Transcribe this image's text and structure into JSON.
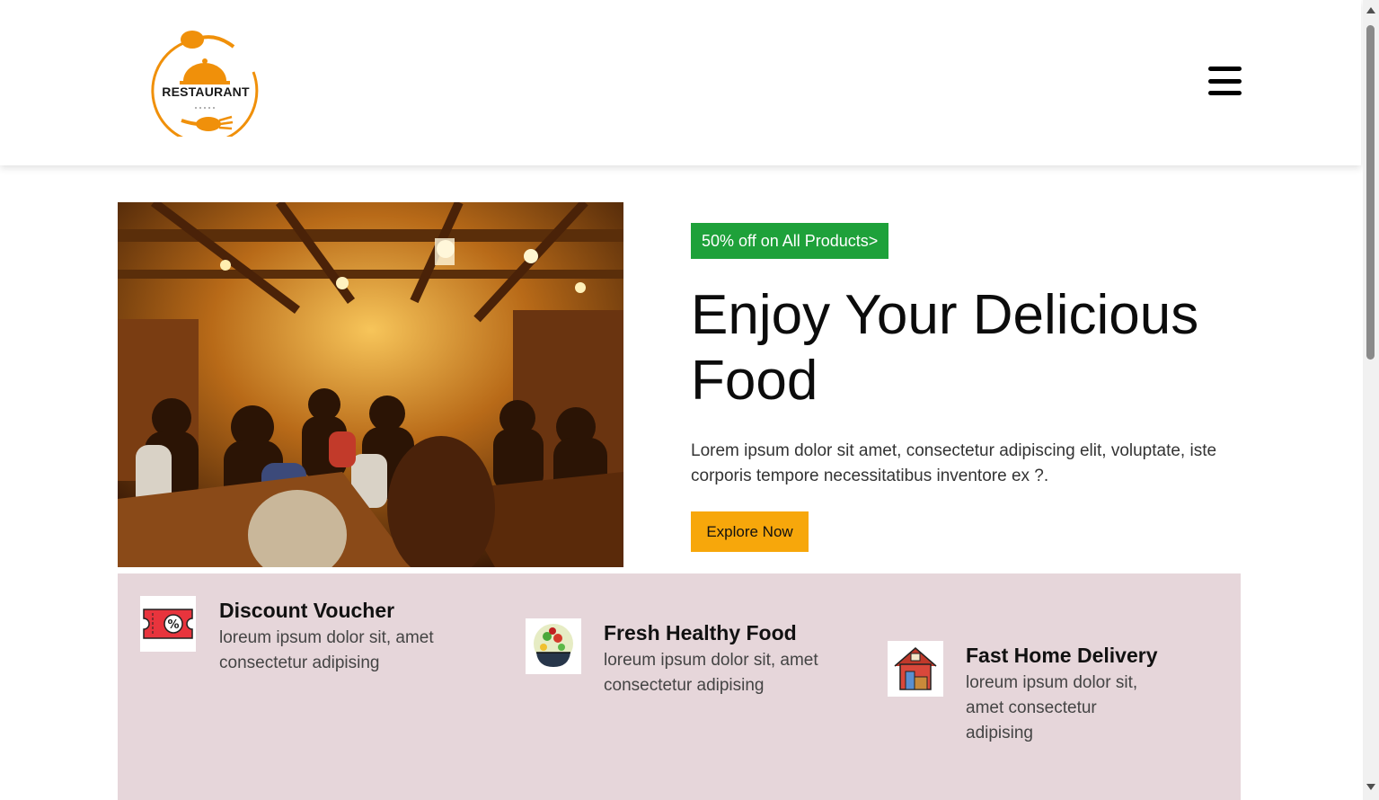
{
  "header": {
    "logo_text": "RESTAURANT",
    "menu_icon": "hamburger-menu-icon"
  },
  "hero": {
    "badge": "50% off on All Products>",
    "title": "Enjoy Your Delicious Food",
    "description": "Lorem ipsum dolor sit amet, consectetur adipiscing elit, voluptate, iste corporis tempore necessitatibus inventore ex ?.",
    "button_label": "Explore Now"
  },
  "features": [
    {
      "icon": "discount-voucher-icon",
      "title": "Discount Voucher",
      "text": "loreum ipsum dolor sit, amet consectetur adipising"
    },
    {
      "icon": "salad-bowl-icon",
      "title": "Fresh Healthy Food",
      "text": "loreum ipsum dolor sit, amet consectetur adipising"
    },
    {
      "icon": "home-delivery-icon",
      "title": "Fast Home Delivery",
      "text": "loreum ipsum dolor sit, amet consectetur adipising"
    }
  ],
  "colors": {
    "accent_orange": "#f7a70b",
    "badge_green": "#1ea13a",
    "feature_bg": "#e6d6da"
  }
}
